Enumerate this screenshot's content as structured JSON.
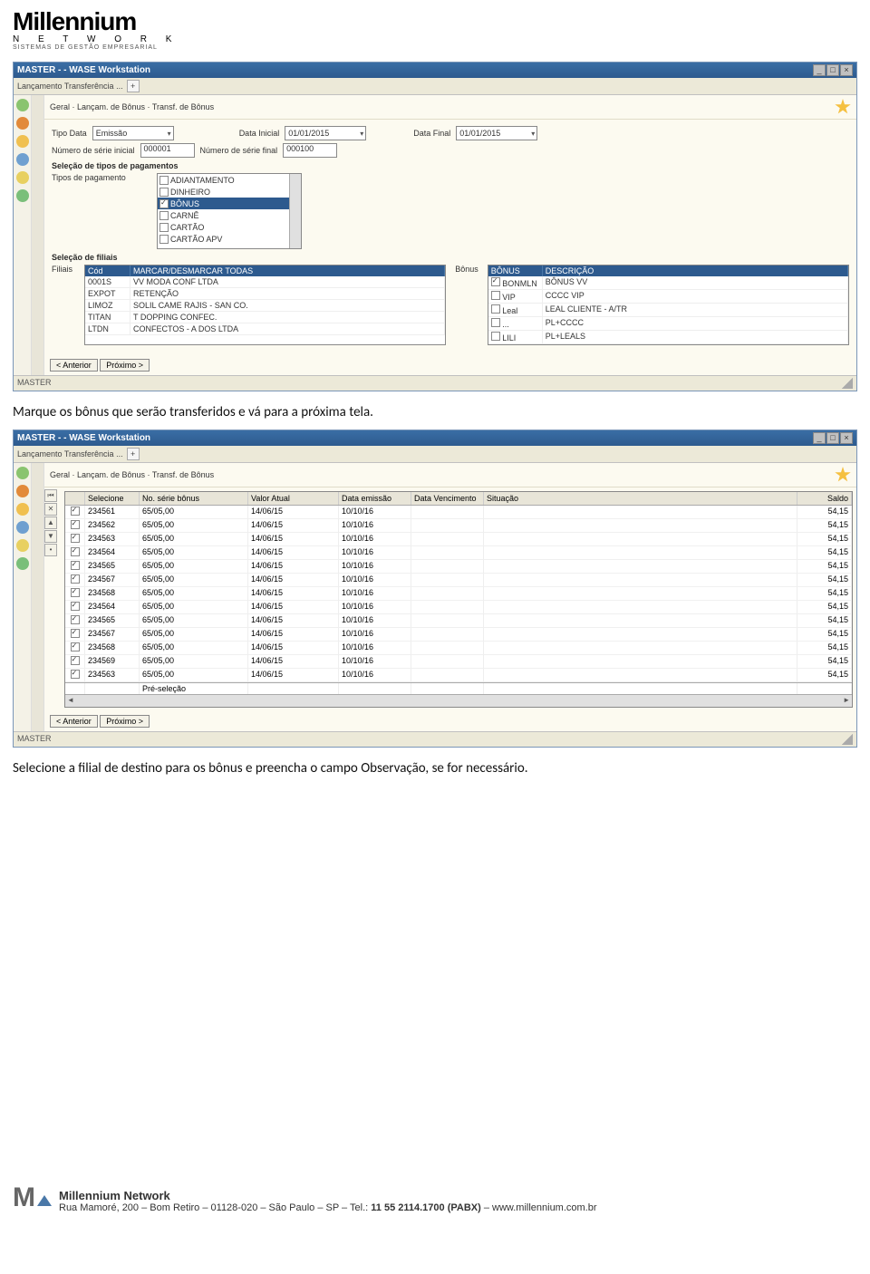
{
  "header": {
    "brand": "Millennium",
    "network_spaced": "N E T W O R K",
    "tagline": "SISTEMAS DE GESTÃO EMPRESARIAL"
  },
  "window1": {
    "title": "MASTER - - WASE Workstation",
    "toolbar_text": "Lançamento  Transferência ...",
    "breadcrumb": "Geral · Lançam. de Bônus · Transf. de Bônus",
    "tipo_data_label": "Tipo Data",
    "tipo_data_value": "Emissão",
    "data_inicial_label": "Data Inicial",
    "data_inicial_value": "01/01/2015",
    "data_final_label": "Data Final",
    "data_final_value": "01/01/2015",
    "numero_inicial_label": "Número de série inicial",
    "numero_inicial_value": "000001",
    "numero_final_label": "Número de série final",
    "numero_final_value": "000100",
    "secao_pag": "Seleção de tipos de pagamentos",
    "tipos_pag_label": "Tipos de pagamento",
    "tipos_pag_options": [
      "ADIANTAMENTO",
      "DINHEIRO",
      "BÔNUS",
      "CARNÊ",
      "CARTÃO",
      "CARTÃO APV"
    ],
    "secao_filiais": "Seleção de filiais",
    "filiais_label": "Filiais",
    "filiais_hdr_cod": "Cód",
    "filiais_hdr_nome": "MARCAR/DESMARCAR TODAS",
    "filiais": [
      {
        "c": "0001S",
        "n": "VV MODA CONF LTDA"
      },
      {
        "c": "EXPOT",
        "n": "RETENÇÃO"
      },
      {
        "c": "LIMOZ",
        "n": "SOLIL CAME RAJIS - SAN CO."
      },
      {
        "c": "TITAN",
        "n": "T DOPPING CONFEC."
      },
      {
        "c": "LTDN",
        "n": "CONFECTOS - A DOS LTDA"
      }
    ],
    "bonus_label": "Bônus",
    "bonus_hdr_cod": "BÔNUS",
    "bonus_hdr_nome": "DESCRIÇÃO",
    "bonus": [
      {
        "c": "BONMLN",
        "n": "BÔNUS VV"
      },
      {
        "c": "VIP",
        "n": "CCCC VIP"
      },
      {
        "c": "Leal",
        "n": "LEAL CLIENTE - A/TR"
      },
      {
        "c": "...",
        "n": "PL+CCCC"
      },
      {
        "c": "LILI",
        "n": "PL+LEALS"
      }
    ],
    "anterior": "< Anterior",
    "proximo": "Próximo >",
    "status": "MASTER"
  },
  "instruction1": "Marque os bônus que serão transferidos e vá para a próxima tela.",
  "window2": {
    "title": "MASTER - - WASE Workstation",
    "toolbar_text": "Lançamento  Transferência ...",
    "breadcrumb": "Geral · Lançam. de Bônus · Transf. de Bônus",
    "grid": {
      "headers": [
        "",
        "Selecione",
        "No. série bônus",
        "Valor Atual",
        "Data emissão",
        "Data Vencimento",
        "Situação",
        "Saldo"
      ],
      "rows": [
        {
          "sel": "✓",
          "serie": "234561",
          "val": "65/05,00",
          "demi": "14/06/15",
          "dvenc": "10/10/16",
          "sit": "",
          "saldo": "54,15"
        },
        {
          "sel": "✓",
          "serie": "234562",
          "val": "65/05,00",
          "demi": "14/06/15",
          "dvenc": "10/10/16",
          "sit": "",
          "saldo": "54,15"
        },
        {
          "sel": "✓",
          "serie": "234563",
          "val": "65/05,00",
          "demi": "14/06/15",
          "dvenc": "10/10/16",
          "sit": "",
          "saldo": "54,15"
        },
        {
          "sel": "✓",
          "serie": "234564",
          "val": "65/05,00",
          "demi": "14/06/15",
          "dvenc": "10/10/16",
          "sit": "",
          "saldo": "54,15"
        },
        {
          "sel": "✓",
          "serie": "234565",
          "val": "65/05,00",
          "demi": "14/06/15",
          "dvenc": "10/10/16",
          "sit": "",
          "saldo": "54,15"
        },
        {
          "sel": "✓",
          "serie": "234567",
          "val": "65/05,00",
          "demi": "14/06/15",
          "dvenc": "10/10/16",
          "sit": "",
          "saldo": "54,15"
        },
        {
          "sel": "✓",
          "serie": "234568",
          "val": "65/05,00",
          "demi": "14/06/15",
          "dvenc": "10/10/16",
          "sit": "",
          "saldo": "54,15"
        },
        {
          "sel": "✓",
          "serie": "234564",
          "val": "65/05,00",
          "demi": "14/06/15",
          "dvenc": "10/10/16",
          "sit": "",
          "saldo": "54,15"
        },
        {
          "sel": "✓",
          "serie": "234565",
          "val": "65/05,00",
          "demi": "14/06/15",
          "dvenc": "10/10/16",
          "sit": "",
          "saldo": "54,15"
        },
        {
          "sel": "✓",
          "serie": "234567",
          "val": "65/05,00",
          "demi": "14/06/15",
          "dvenc": "10/10/16",
          "sit": "",
          "saldo": "54,15"
        },
        {
          "sel": "✓",
          "serie": "234568",
          "val": "65/05,00",
          "demi": "14/06/15",
          "dvenc": "10/10/16",
          "sit": "",
          "saldo": "54,15"
        },
        {
          "sel": "✓",
          "serie": "234569",
          "val": "65/05,00",
          "demi": "14/06/15",
          "dvenc": "10/10/16",
          "sit": "",
          "saldo": "54,15"
        },
        {
          "sel": "✓",
          "serie": "234563",
          "val": "65/05,00",
          "demi": "14/06/15",
          "dvenc": "10/10/16",
          "sit": "",
          "saldo": "54,15"
        }
      ],
      "footer_total_label": "Pré-seleção",
      "footer_total": ""
    },
    "anterior": "< Anterior",
    "proximo": "Próximo >",
    "status": "MASTER"
  },
  "instruction2": "Selecione a filial de destino para os bônus e preencha o campo Observação, se for necessário.",
  "footer": {
    "company": "Millennium Network",
    "address": "Rua Mamoré, 200 – Bom Retiro – 01128-020 – São Paulo – SP – Tel.: ",
    "tel": "11 55 2114.1700 (PABX)",
    "site": " – www.millennium.com.br"
  },
  "colors": {
    "winblue": "#2d5a8e"
  }
}
